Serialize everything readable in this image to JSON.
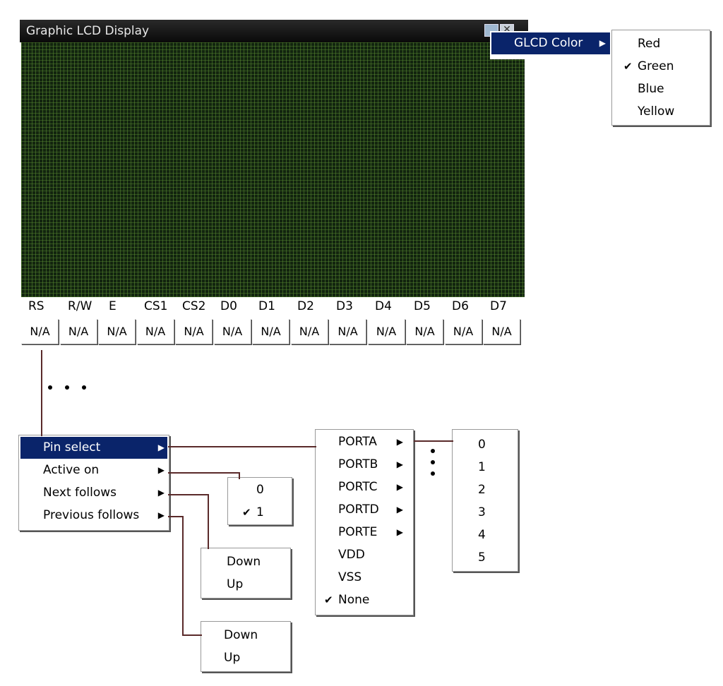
{
  "window": {
    "title": "Graphic LCD Display",
    "buttons": [
      "minimize-icon",
      "close-icon"
    ],
    "screen_color": "#12240f",
    "title_bar_color": "#0a0a0a"
  },
  "pins": {
    "labels": [
      "RS",
      "R/W",
      "E",
      "CS1",
      "CS2",
      "D0",
      "D1",
      "D2",
      "D3",
      "D4",
      "D5",
      "D6",
      "D7"
    ],
    "values": [
      "N/A",
      "N/A",
      "N/A",
      "N/A",
      "N/A",
      "N/A",
      "N/A",
      "N/A",
      "N/A",
      "N/A",
      "N/A",
      "N/A",
      "N/A"
    ]
  },
  "glcd_menu": {
    "label": "GLCD Color",
    "colors": [
      "Red",
      "Green",
      "Blue",
      "Yellow"
    ],
    "checked": "Green"
  },
  "pin_menu": {
    "items": [
      "Pin select",
      "Active on",
      "Next follows",
      "Previous follows"
    ],
    "selected": "Pin select"
  },
  "active_on_menu": {
    "items": [
      "0",
      "1"
    ],
    "checked": "1"
  },
  "next_follows_menu": {
    "items": [
      "Down",
      "Up"
    ]
  },
  "previous_follows_menu": {
    "items": [
      "Down",
      "Up"
    ]
  },
  "port_menu": {
    "items": [
      "PORTA",
      "PORTB",
      "PORTC",
      "PORTD",
      "PORTE",
      "VDD",
      "VSS",
      "None"
    ],
    "submenu_items": [
      "PORTA",
      "PORTB",
      "PORTC",
      "PORTD",
      "PORTE"
    ],
    "checked": "None"
  },
  "bit_menu": {
    "items": [
      "0",
      "1",
      "2",
      "3",
      "4",
      "5"
    ]
  },
  "highlight_color": "#0a246a",
  "connector_color": "#5a2a2a"
}
